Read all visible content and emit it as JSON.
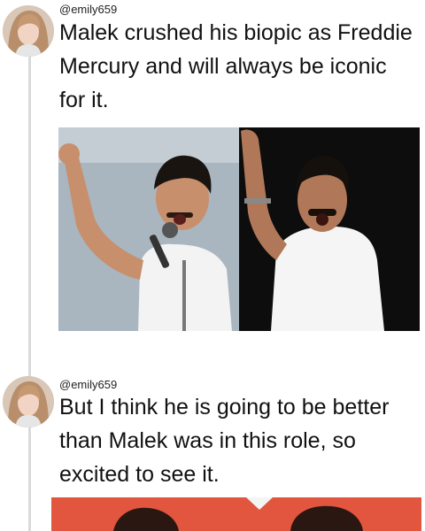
{
  "tweets": [
    {
      "handle": "@emily659",
      "text": "Malek crushed his biopic as Freddie Mercury and will always be iconic for it."
    },
    {
      "handle": "@emily659",
      "text": "But I think he is going to be better than Malek was in this role, so excited to see it."
    }
  ],
  "colors": {
    "thread_line": "#d8dadc",
    "left_photo_bg": "#a9b6bf",
    "right_photo_bg": "#0d0d0d",
    "preview_bg": "#e2553f"
  },
  "icons": {
    "avatar": "user-avatar-photo",
    "media": "freddie-mercury-comparison-photo"
  }
}
